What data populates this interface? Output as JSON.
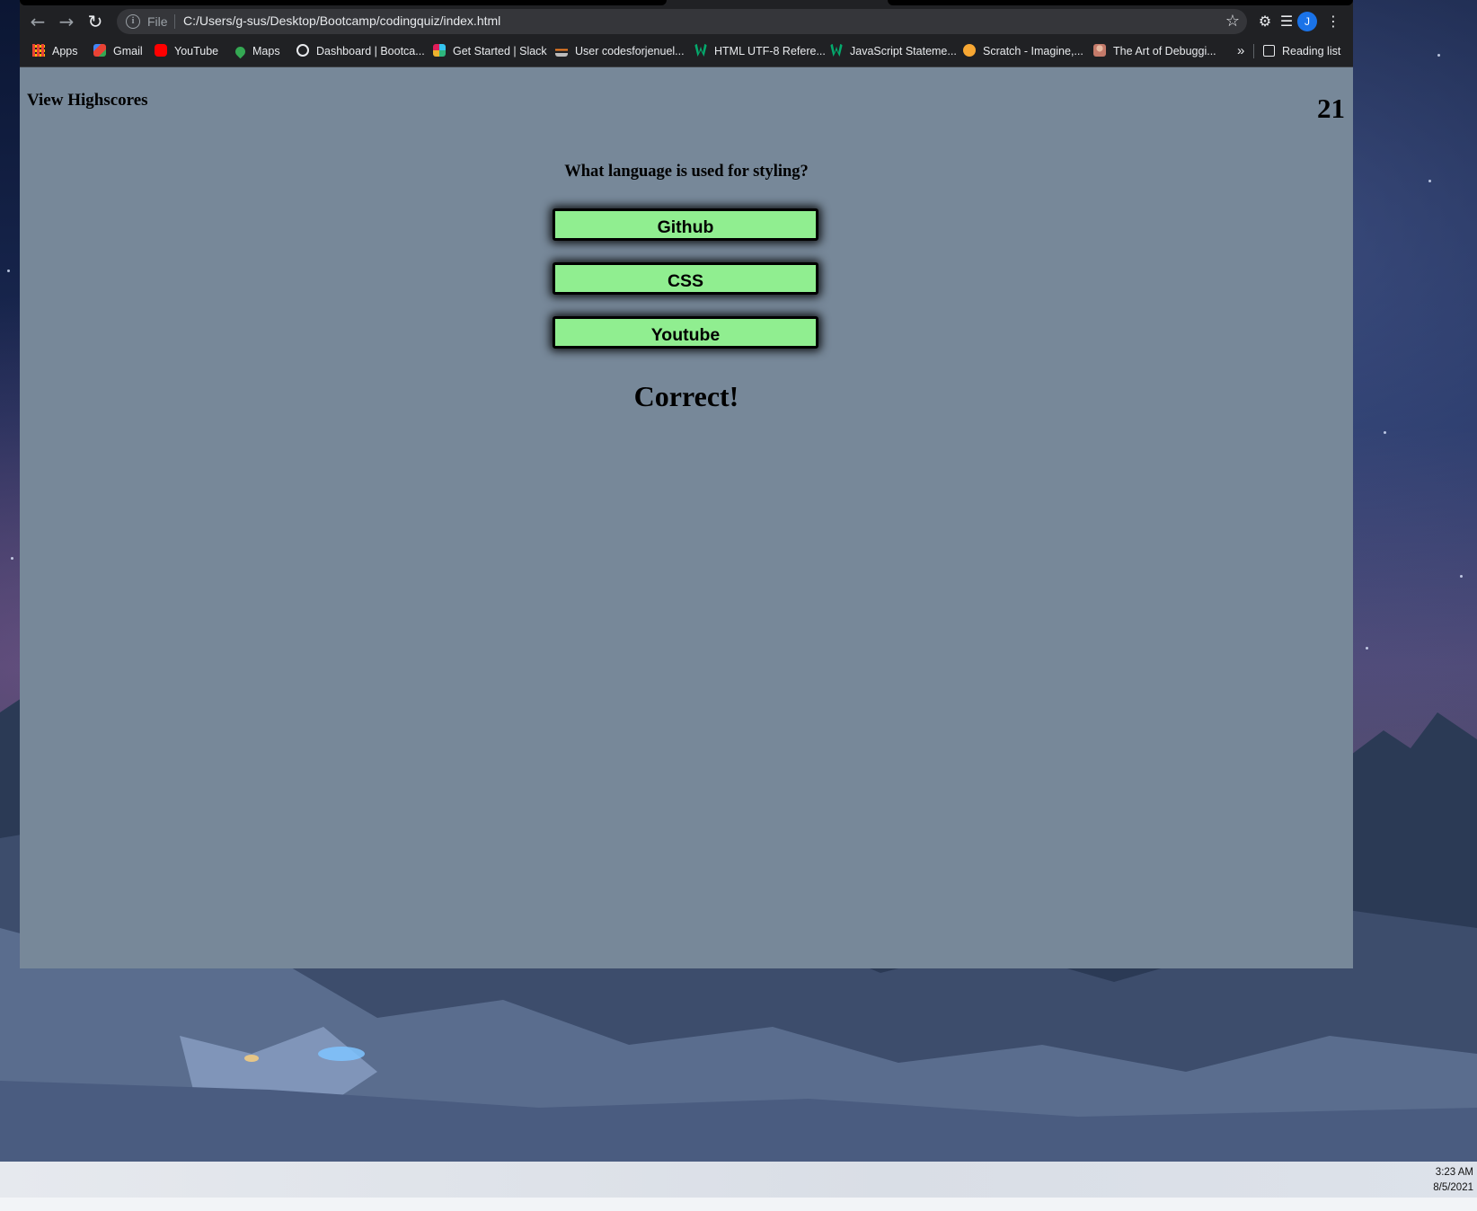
{
  "browser": {
    "url_prefix": "File",
    "url": "C:/Users/g-sus/Desktop/Bootcamp/codingquiz/index.html",
    "profile_initial": "J",
    "bookmarks": [
      {
        "label": "Apps",
        "icon": "apps-grid-icon",
        "color": "#ea4335"
      },
      {
        "label": "Gmail",
        "icon": "gmail-icon",
        "color": "#ea4335"
      },
      {
        "label": "YouTube",
        "icon": "youtube-icon",
        "color": "#ff0000"
      },
      {
        "label": "Maps",
        "icon": "maps-icon",
        "color": "#34a853"
      },
      {
        "label": "Dashboard | Bootca...",
        "icon": "globe-icon",
        "color": "#e8eaed"
      },
      {
        "label": "Get Started | Slack",
        "icon": "slack-icon",
        "color": "#e01e5a"
      },
      {
        "label": "User codesforjenuel...",
        "icon": "stackoverflow-icon",
        "color": "#f48024"
      },
      {
        "label": "HTML UTF-8 Refere...",
        "icon": "w3schools-icon",
        "color": "#04aa6d"
      },
      {
        "label": "JavaScript Stateme...",
        "icon": "w3schools-icon",
        "color": "#04aa6d"
      },
      {
        "label": "Scratch - Imagine,...",
        "icon": "scratch-icon",
        "color": "#f7a733"
      },
      {
        "label": "The Art of Debuggi...",
        "icon": "person-icon",
        "color": "#c47a6a"
      }
    ],
    "overflow_label": "»",
    "reading_list_label": "Reading list"
  },
  "quiz": {
    "highscores_link": "View Highscores",
    "timer": "21",
    "question": "What language is used for styling?",
    "answers": [
      "Github",
      "CSS",
      "Youtube"
    ],
    "feedback": "Correct!",
    "background_color": "#778899",
    "button_color": "#90ee90"
  },
  "taskbar": {
    "time": "3:23 AM",
    "date": "8/5/2021"
  }
}
